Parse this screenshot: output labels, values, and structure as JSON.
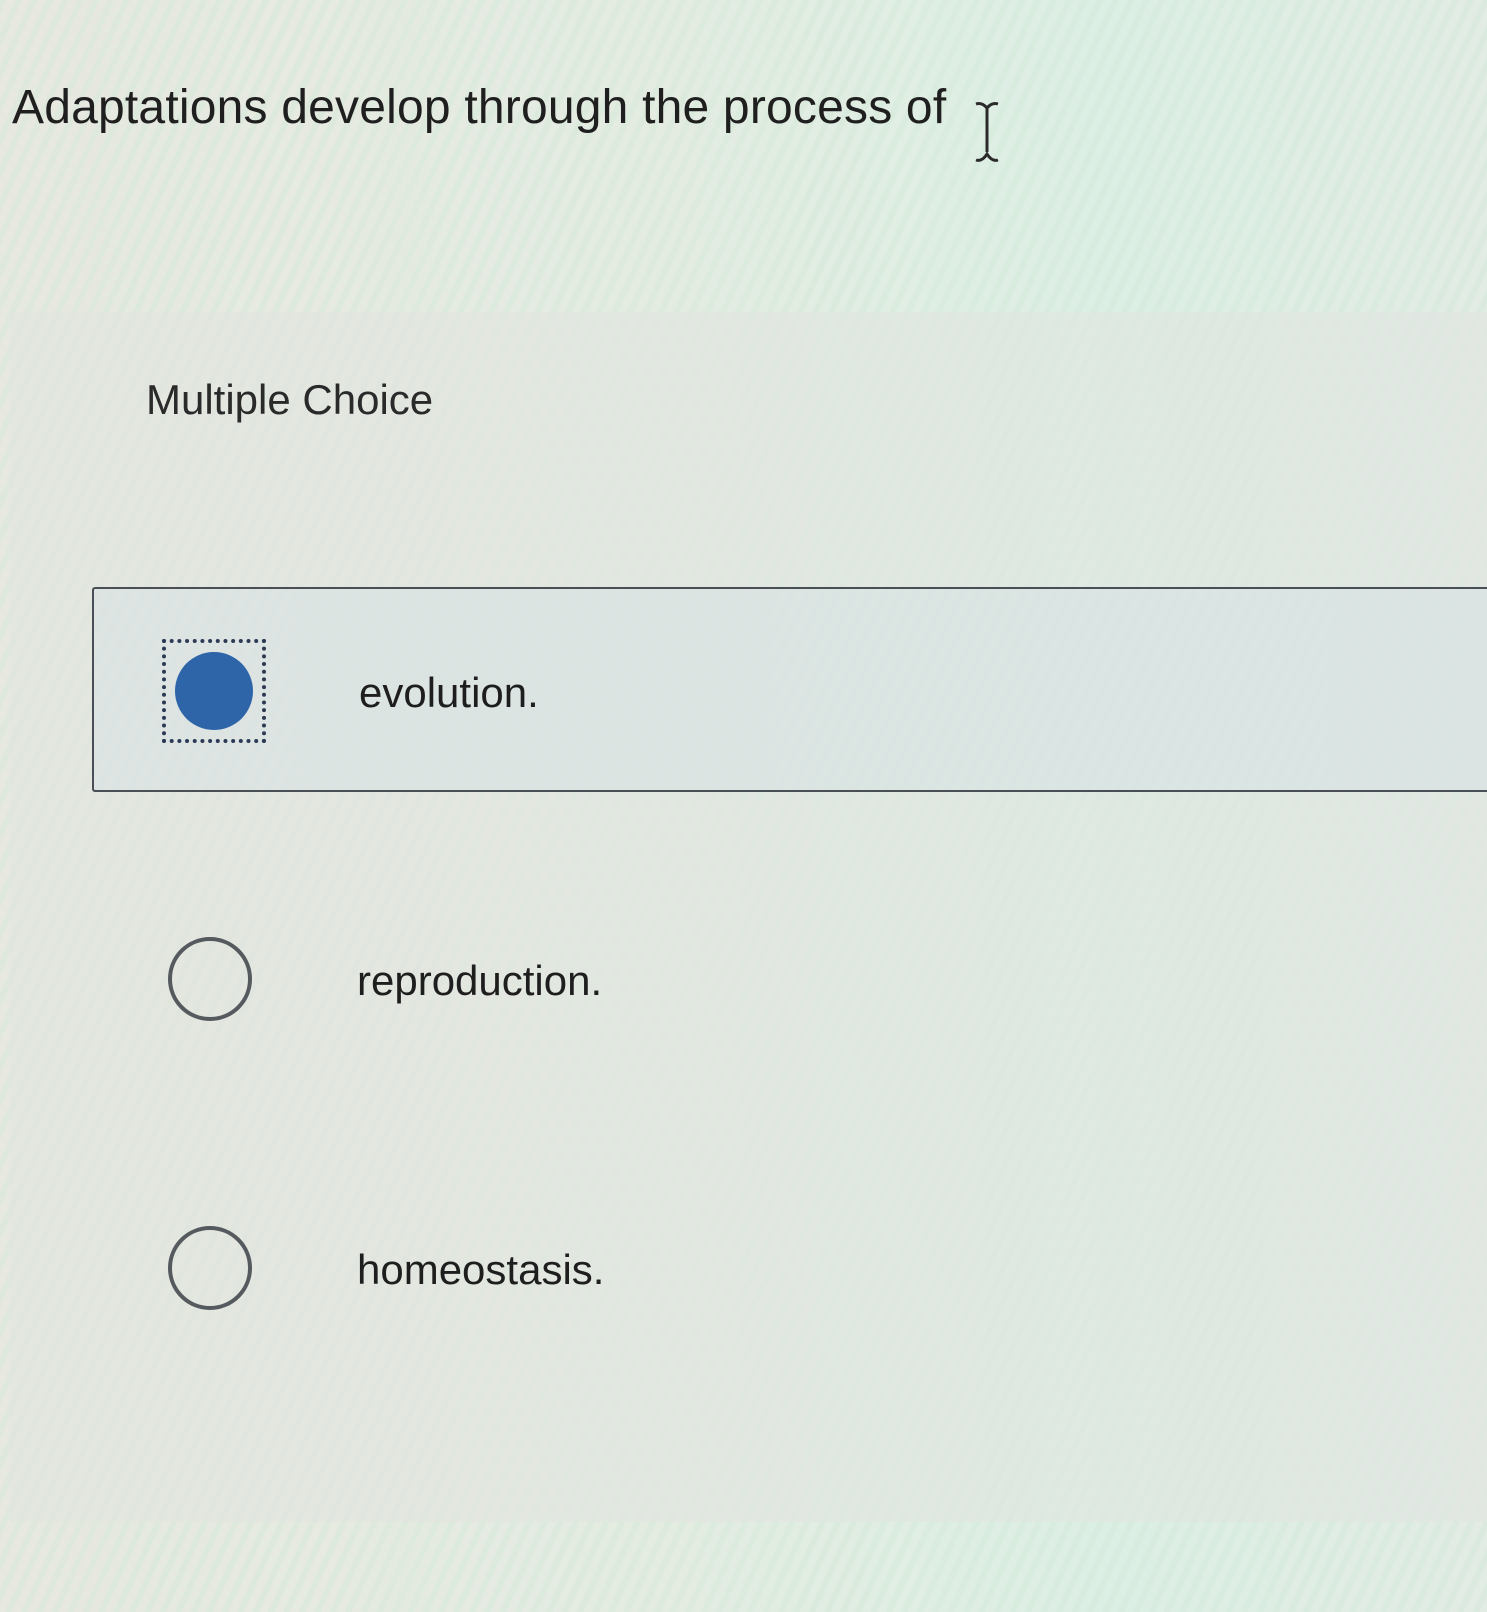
{
  "question": {
    "text": "Adaptations develop through the process of"
  },
  "question_type": "Multiple Choice",
  "options": [
    {
      "label": "evolution.",
      "selected": true
    },
    {
      "label": "reproduction.",
      "selected": false
    },
    {
      "label": "homeostasis.",
      "selected": false
    }
  ],
  "colors": {
    "selected_radio": "#2e64a8",
    "selected_border": "#4a4f55",
    "radio_outline": "#555a5e"
  },
  "icons": {
    "cursor": "text-cursor-icon",
    "selected_radio": "radio-selected-icon",
    "empty_radio": "radio-empty-icon"
  }
}
